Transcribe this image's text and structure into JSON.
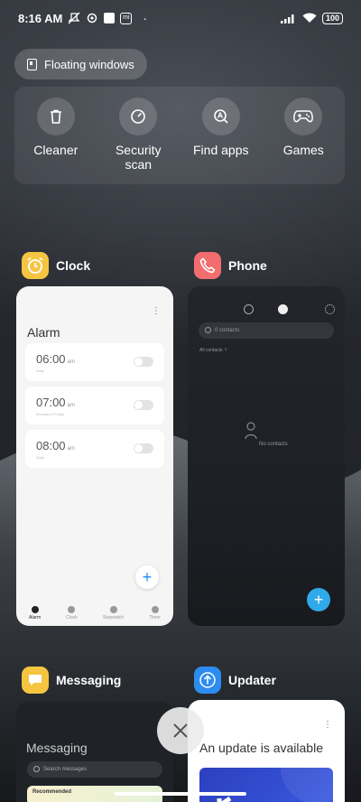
{
  "status_bar": {
    "time": "8:16 AM",
    "battery": "100",
    "dot": "·",
    "icons_left": [
      "mute-icon",
      "settings-icon",
      "square-icon",
      "mi-icon"
    ],
    "icons_right": [
      "signal-icon",
      "wifi-icon",
      "battery-icon"
    ]
  },
  "floating_windows": {
    "label": "Floating windows",
    "icon": "floating-window-icon"
  },
  "quick_actions": [
    {
      "label": "Cleaner",
      "icon": "trash-icon"
    },
    {
      "label": "Security scan",
      "icon": "speedometer-icon"
    },
    {
      "label": "Find apps",
      "icon": "search-app-icon"
    },
    {
      "label": "Games",
      "icon": "gamepad-icon"
    }
  ],
  "apps": {
    "clock": {
      "name": "Clock",
      "icon": "alarm-clock-icon",
      "icon_color": "#f5c542",
      "more": "⋮",
      "title": "Alarm",
      "alarms": [
        {
          "time": "06:00",
          "ampm": "am",
          "sub": "Daily"
        },
        {
          "time": "07:00",
          "ampm": "am",
          "sub": "Monday to Friday"
        },
        {
          "time": "08:00",
          "ampm": "am",
          "sub": "Daily"
        }
      ],
      "fab": "+",
      "tabs": [
        "Alarm",
        "Clock",
        "Stopwatch",
        "Timer"
      ]
    },
    "phone": {
      "name": "Phone",
      "icon": "phone-icon",
      "icon_color": "#f26d6d",
      "search_placeholder": "0 contacts",
      "all_contacts": "All contacts ⇡",
      "no_contacts": "No contacts",
      "fab": "+"
    },
    "messaging": {
      "name": "Messaging",
      "icon": "chat-bubble-icon",
      "icon_color": "#f5c542",
      "title": "Messaging",
      "search_placeholder": "Search messages",
      "recommended": "Recommended"
    },
    "updater": {
      "name": "Updater",
      "icon": "upload-arrow-icon",
      "icon_color": "#2d8cf0",
      "more": "⋮",
      "title": "An update is available"
    }
  },
  "close_all": {
    "icon": "close-icon"
  }
}
